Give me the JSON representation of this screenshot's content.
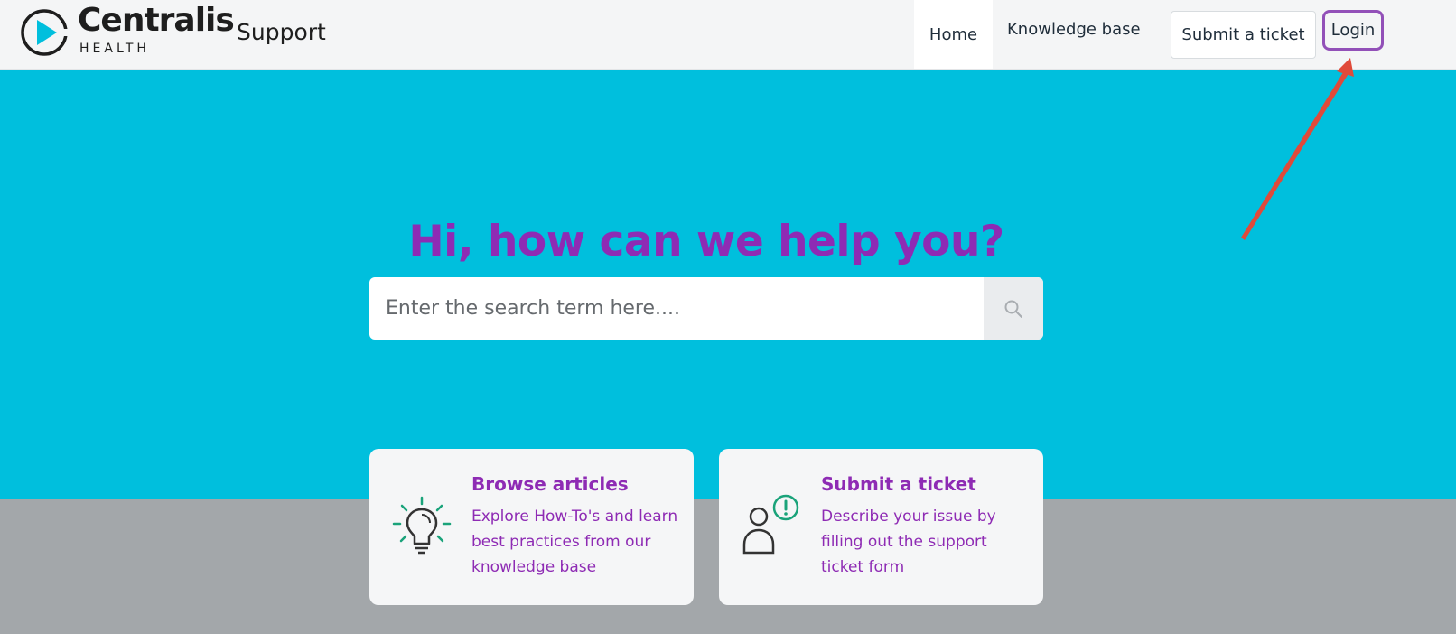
{
  "header": {
    "brand_name": "Centralis",
    "brand_sub": "HEALTH",
    "support_label": "Support",
    "nav": {
      "home": "Home",
      "knowledge_base": "Knowledge base",
      "submit_ticket": "Submit a ticket",
      "login": "Login"
    }
  },
  "hero": {
    "title": "Hi, how can we help you?",
    "search_placeholder": "Enter the search term here....",
    "search_icon": "search-icon"
  },
  "cards": [
    {
      "title": "Browse articles",
      "description": "Explore How-To's and learn best practices from our knowledge base",
      "icon": "lightbulb-icon"
    },
    {
      "title": "Submit a ticket",
      "description": "Describe your issue by filling out the support ticket form",
      "icon": "user-alert-icon"
    }
  ],
  "colors": {
    "hero_bg": "#00bfdd",
    "accent_purple": "#8e2bb4",
    "icon_green": "#1aa37a",
    "annotation_red": "#e04a3a",
    "login_highlight": "#9250b8"
  }
}
